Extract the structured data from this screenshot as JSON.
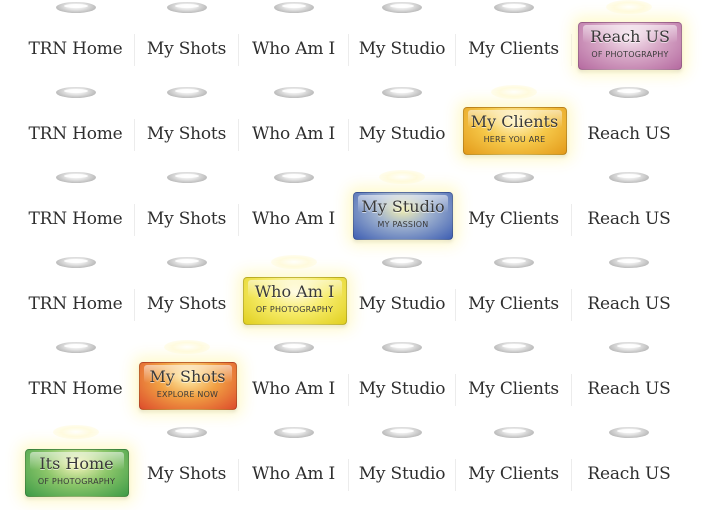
{
  "rows": [
    {
      "nav": [
        "TRN Home",
        "My Shots",
        "Who Am I",
        "My Studio",
        "My Clients"
      ],
      "active": {
        "title": "Reach US",
        "subtitle": "OF PHOTOGRAPHY"
      }
    },
    {
      "nav": [
        "TRN Home",
        "My Shots",
        "Who Am I",
        "My Studio",
        "Reach US"
      ],
      "active": {
        "title": "My Clients",
        "subtitle": "HERE YOU ARE"
      }
    },
    {
      "nav": [
        "TRN Home",
        "My Shots",
        "Who Am I",
        "My Clients",
        "Reach US"
      ],
      "active": {
        "title": "My Studio",
        "subtitle": "MY PASSION"
      }
    },
    {
      "nav": [
        "TRN Home",
        "My Shots",
        "My Studio",
        "My Clients",
        "Reach US"
      ],
      "active": {
        "title": "Who Am I",
        "subtitle": "OF PHOTOGRAPHY"
      }
    },
    {
      "nav": [
        "TRN Home",
        "Who Am I",
        "My Studio",
        "My Clients",
        "Reach US"
      ],
      "active": {
        "title": "My Shots",
        "subtitle": "EXPLORE NOW"
      }
    },
    {
      "nav": [
        "My Shots",
        "Who Am I",
        "My Studio",
        "My Clients",
        "Reach US"
      ],
      "active": {
        "title": "Its Home",
        "subtitle": "OF PHOTOGRAPHY"
      }
    }
  ],
  "badge_colors": {
    "reach_us": "#b56aa0",
    "my_clients": "#e5a71f",
    "my_studio": "#3f5fb3",
    "who_am_i": "#e3d52b",
    "my_shots": "#dd4c2c",
    "its_home": "#3d9b47"
  }
}
